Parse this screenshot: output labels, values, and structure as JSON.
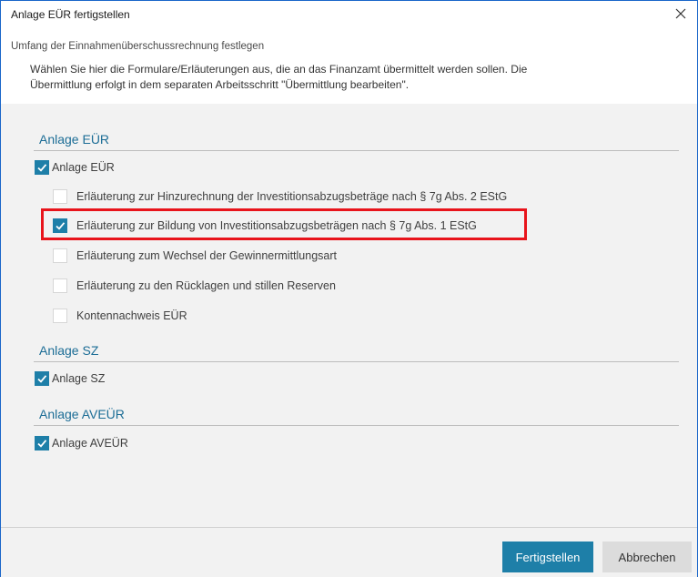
{
  "window": {
    "title": "Anlage EÜR fertigstellen"
  },
  "header": {
    "heading": "Umfang der Einnahmenüberschussrechnung festlegen",
    "description_line1": "Wählen Sie hier die Formulare/Erläuterungen aus, die an das Finanzamt übermittelt werden sollen. Die",
    "description_line2": "Übermittlung erfolgt in dem separaten Arbeitsschritt \"Übermittlung bearbeiten\"."
  },
  "sections": {
    "eur": {
      "title": "Anlage EÜR",
      "main_checkbox": {
        "label": "Anlage EÜR",
        "checked": true
      },
      "items": [
        {
          "label": "Erläuterung zur Hinzurechnung der Investitionsabzugsbeträge nach § 7g Abs. 2 EStG",
          "checked": false
        },
        {
          "label": "Erläuterung zur Bildung von Investitionsabzugsbeträgen nach § 7g Abs. 1 EStG",
          "checked": true
        },
        {
          "label": "Erläuterung zum Wechsel der Gewinnermittlungsart",
          "checked": false
        },
        {
          "label": "Erläuterung zu den Rücklagen und stillen Reserven",
          "checked": false
        },
        {
          "label": "Kontennachweis EÜR",
          "checked": false
        }
      ]
    },
    "sz": {
      "title": "Anlage SZ",
      "main_checkbox": {
        "label": "Anlage SZ",
        "checked": true
      }
    },
    "aveur": {
      "title": "Anlage AVEÜR",
      "main_checkbox": {
        "label": "Anlage AVEÜR",
        "checked": true
      }
    }
  },
  "footer": {
    "primary_button": "Fertigstellen",
    "secondary_button": "Abbrechen"
  },
  "colors": {
    "accent": "#1e7fa8",
    "section_title": "#1c6d96",
    "highlight": "#e8141b",
    "window_border": "#1a66c9"
  }
}
